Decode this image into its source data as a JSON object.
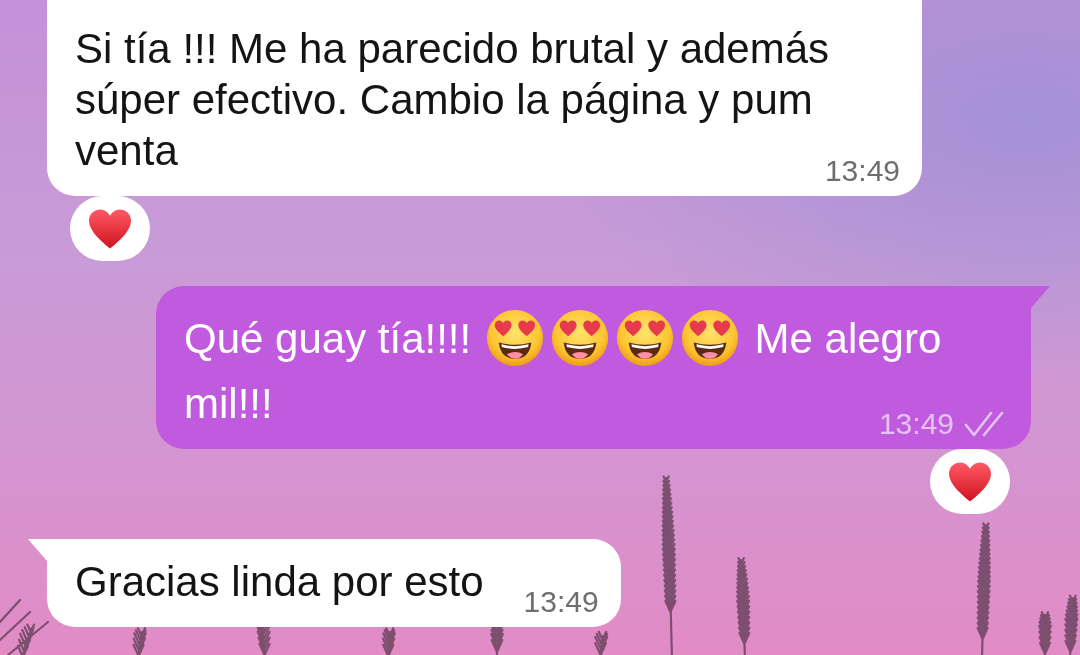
{
  "messages": [
    {
      "kind": "incoming",
      "parts": [
        {
          "kind": "text",
          "text": "Si tía !!! Me ha parecido brutal y además súper efectivo. Cambio la página y pum venta"
        }
      ],
      "time": "13:49",
      "reacted": true
    },
    {
      "kind": "outgoing",
      "parts": [
        {
          "kind": "text",
          "text": "Qué guay tía!!!!"
        },
        {
          "kind": "emoji"
        },
        {
          "kind": "emoji"
        },
        {
          "kind": "emoji"
        },
        {
          "kind": "emoji"
        },
        {
          "kind": "text",
          "text": "Me alegro mil!!!"
        }
      ],
      "time": "13:49",
      "delivered": true,
      "read": false,
      "reacted": true
    },
    {
      "kind": "incoming",
      "parts": [
        {
          "kind": "text",
          "text": "Gracias linda por esto"
        }
      ],
      "time": "13:49",
      "reacted": false
    }
  ]
}
